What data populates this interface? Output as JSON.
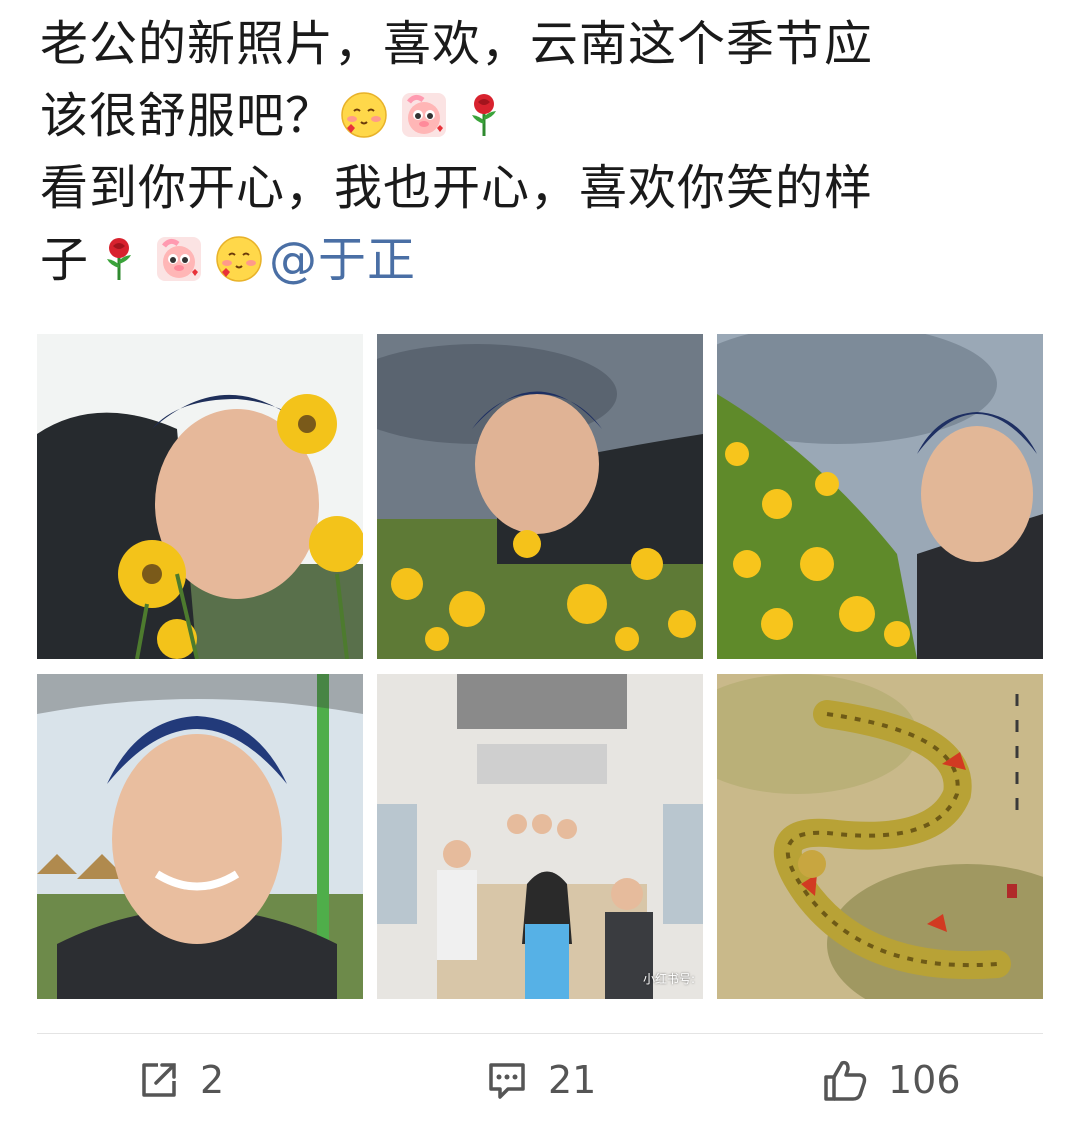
{
  "post": {
    "line1": "老公的新照片，喜欢，云南这个季节应",
    "line2": "该很舒服吧？",
    "line3": "看到你开心，我也开心，喜欢你笑的样",
    "line4": "子",
    "mention": "@于正"
  },
  "emoji": {
    "line2": [
      "blush-emoji",
      "flower-pig-emoji",
      "rose-emoji"
    ],
    "line4": [
      "rose-emoji",
      "flower-pig-emoji",
      "blush-emoji"
    ]
  },
  "photos": [
    {
      "name": "photo-selfie-flowers-1"
    },
    {
      "name": "photo-selfie-flowers-2"
    },
    {
      "name": "photo-selfie-flowers-3"
    },
    {
      "name": "photo-selfie-bus"
    },
    {
      "name": "photo-group-bus",
      "watermark": "小红书号:"
    },
    {
      "name": "photo-dragon-painting"
    }
  ],
  "actions": {
    "repost": {
      "icon": "share-icon",
      "count": "2"
    },
    "comment": {
      "icon": "comment-icon",
      "count": "21"
    },
    "like": {
      "icon": "thumbs-up-icon",
      "count": "106"
    }
  },
  "colors": {
    "mention": "#4a6fa5",
    "text": "#1a1a1a",
    "count": "#555555"
  }
}
